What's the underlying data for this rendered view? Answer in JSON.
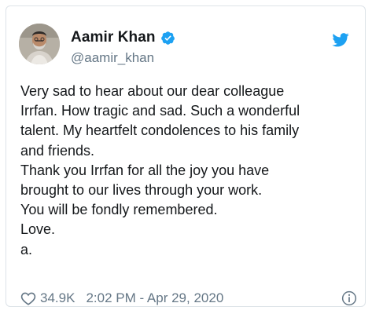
{
  "author": {
    "display_name": "Aamir Khan",
    "handle": "@aamir_khan",
    "verified": true
  },
  "tweet": {
    "lines": [
      "Very sad to hear about our dear colleague",
      "Irrfan. How tragic and sad. Such a wonderful",
      "talent. My heartfelt condolences to his family",
      "and friends.",
      "Thank you Irrfan for all the joy you have",
      "brought to our lives through your work.",
      "You will be fondly remembered.",
      "Love.",
      "a."
    ]
  },
  "footer": {
    "likes": "34.9K",
    "timestamp": "2:02 PM - Apr 29, 2020"
  },
  "icons": {
    "brand": "twitter-bird-icon",
    "verified": "verified-badge-icon",
    "like": "heart-icon",
    "info": "info-icon"
  },
  "colors": {
    "twitter_blue": "#1da1f2",
    "text_primary": "#14171a",
    "text_secondary": "#657786",
    "border": "#dde3e8"
  }
}
